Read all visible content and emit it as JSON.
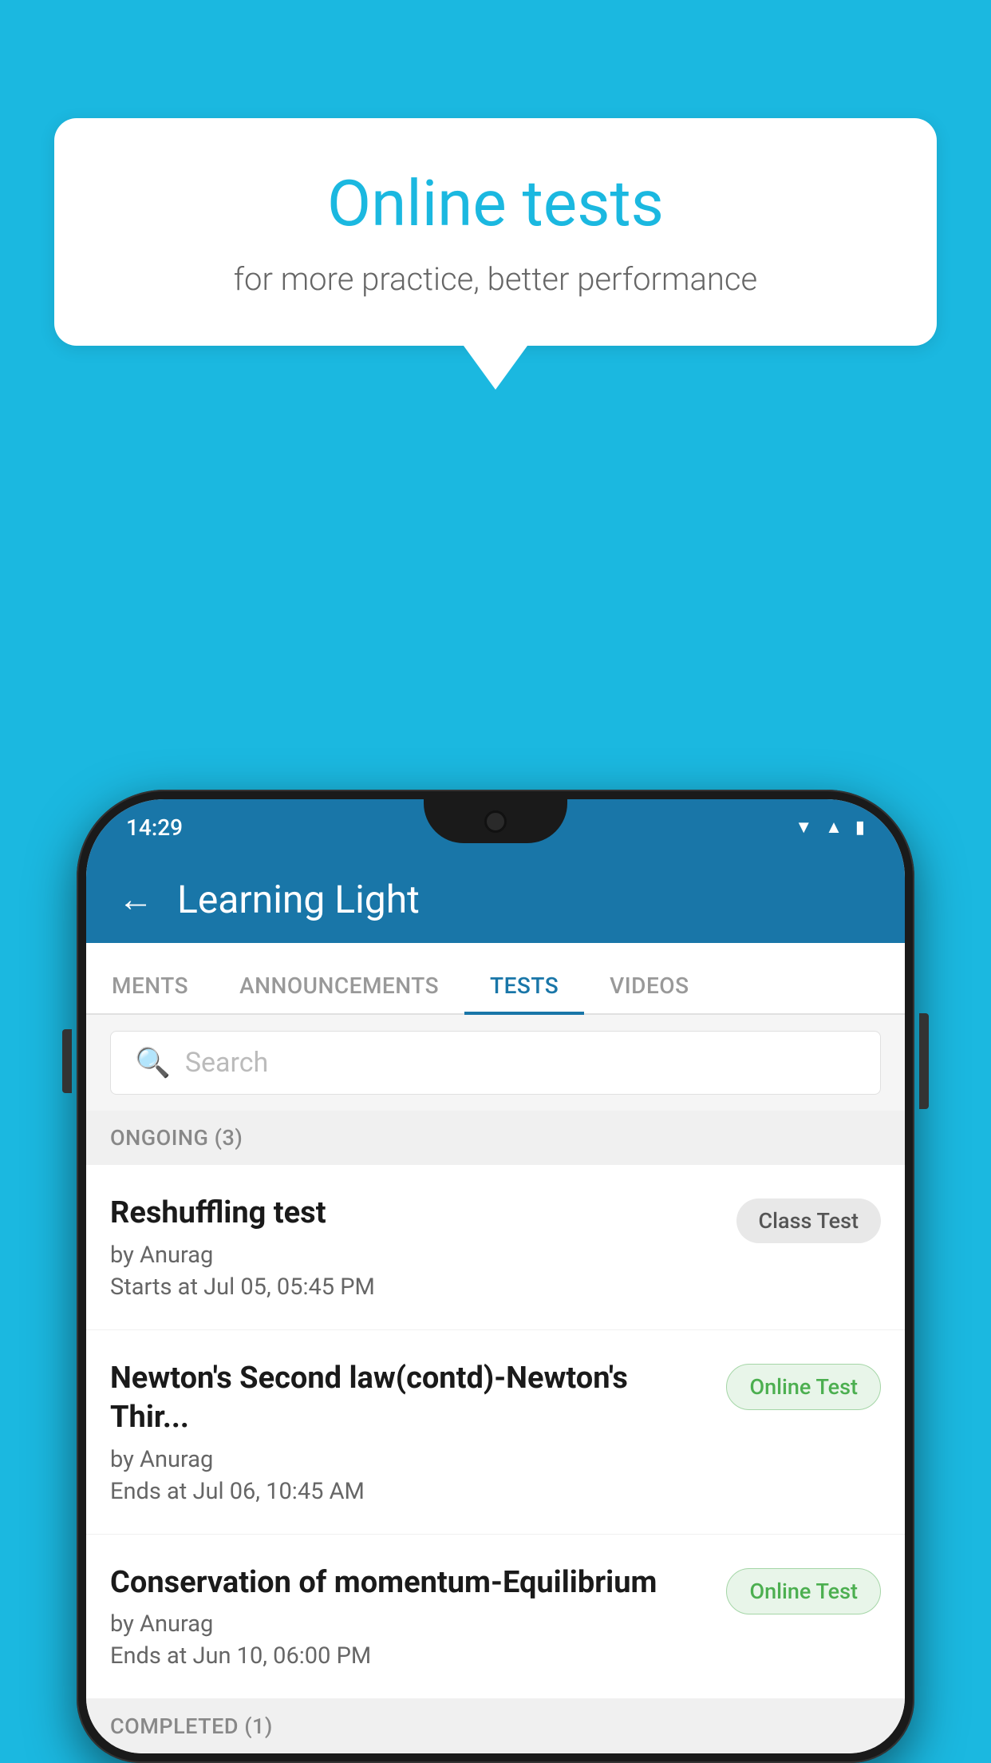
{
  "background": {
    "color": "#1BB8E0"
  },
  "speech_bubble": {
    "title": "Online tests",
    "subtitle": "for more practice, better performance"
  },
  "phone": {
    "status_bar": {
      "time": "14:29",
      "icons": [
        "wifi",
        "signal",
        "battery"
      ]
    },
    "app_header": {
      "title": "Learning Light",
      "back_label": "←"
    },
    "tabs": [
      {
        "label": "MENTS",
        "active": false
      },
      {
        "label": "ANNOUNCEMENTS",
        "active": false
      },
      {
        "label": "TESTS",
        "active": true
      },
      {
        "label": "VIDEOS",
        "active": false
      }
    ],
    "search": {
      "placeholder": "Search"
    },
    "ongoing_section": {
      "header": "ONGOING (3)",
      "tests": [
        {
          "name": "Reshuffling test",
          "author": "by Anurag",
          "date": "Starts at  Jul 05, 05:45 PM",
          "badge": "Class Test",
          "badge_type": "class"
        },
        {
          "name": "Newton's Second law(contd)-Newton's Thir...",
          "author": "by Anurag",
          "date": "Ends at  Jul 06, 10:45 AM",
          "badge": "Online Test",
          "badge_type": "online"
        },
        {
          "name": "Conservation of momentum-Equilibrium",
          "author": "by Anurag",
          "date": "Ends at  Jun 10, 06:00 PM",
          "badge": "Online Test",
          "badge_type": "online"
        }
      ]
    },
    "completed_section": {
      "header": "COMPLETED (1)"
    }
  }
}
